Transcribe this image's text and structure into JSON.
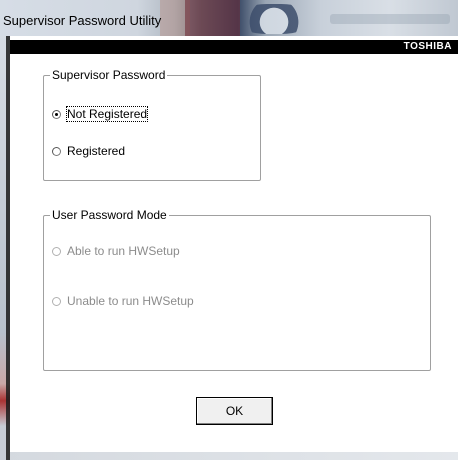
{
  "window": {
    "title": "Supervisor Password Utility",
    "brand": "TOSHIBA"
  },
  "supervisor_group": {
    "legend": "Supervisor Password",
    "options": [
      {
        "label": "Not Registered",
        "checked": true
      },
      {
        "label": "Registered",
        "checked": false
      }
    ]
  },
  "user_mode_group": {
    "legend": "User Password Mode",
    "options": [
      {
        "label": "Able to run HWSetup",
        "enabled": false
      },
      {
        "label": "Unable to run HWSetup",
        "enabled": false
      }
    ]
  },
  "buttons": {
    "ok_label": "OK"
  },
  "colors": {
    "brand_bar": "#000000",
    "dialog_bg": "#ffffff",
    "disabled_text": "#8c8c8c"
  }
}
